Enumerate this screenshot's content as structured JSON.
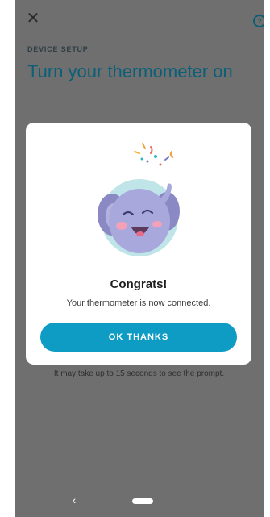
{
  "header": {
    "close_icon": "close-icon",
    "help_icon": "help-icon",
    "overline": "DEVICE SETUP",
    "title": "Turn your thermometer on"
  },
  "background": {
    "hint": "It may take up to 15 seconds to see the prompt."
  },
  "dialog": {
    "illustration": "elephant-celebration-icon",
    "title": "Congrats!",
    "message": "Your thermometer is now connected.",
    "ok_label": "OK THANKS"
  },
  "colors": {
    "accent": "#0f9cc4",
    "heading": "#0b5f78",
    "scrim_background": "#6f6f6f",
    "dialog_background": "#ffffff"
  },
  "nav": {
    "back_icon": "back-chevron-icon",
    "home_icon": "home-pill-icon"
  }
}
